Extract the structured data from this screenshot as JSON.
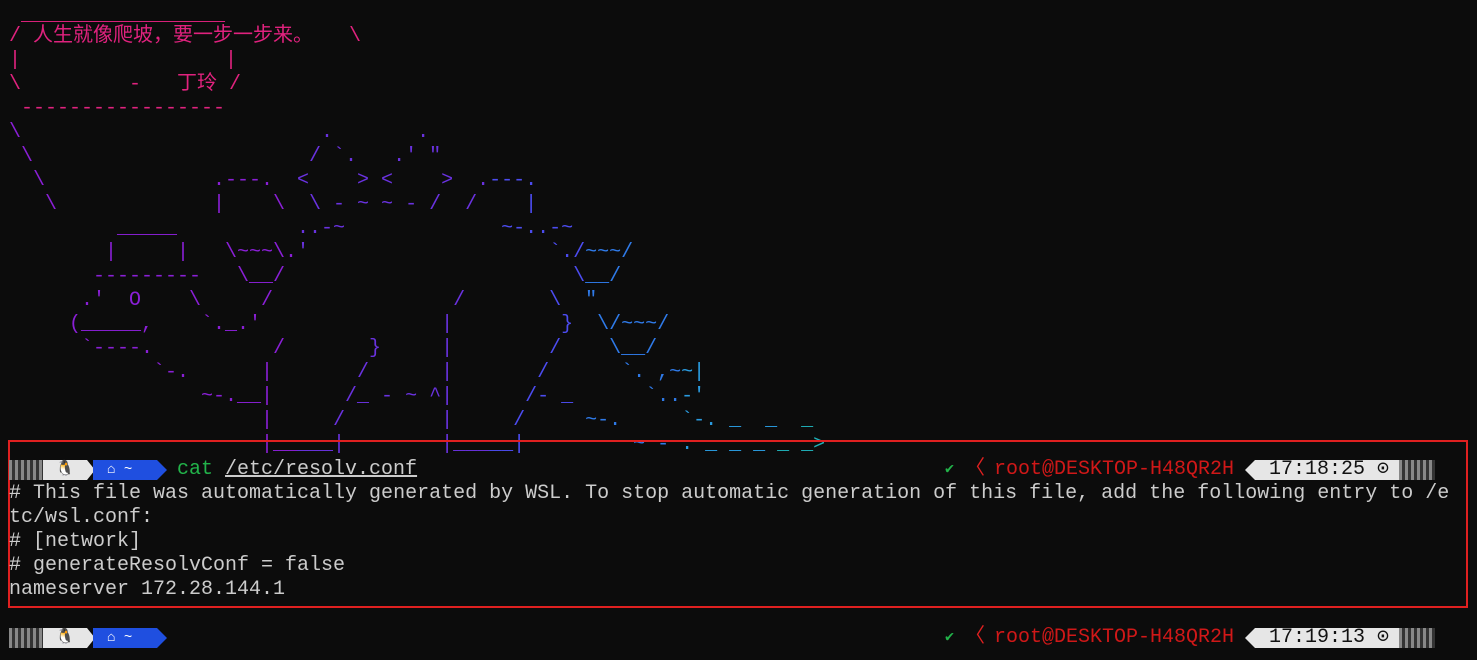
{
  "cowsay": {
    "top": " _________________",
    "line1": "/ 人生就像爬坡，要一步一步来。   \\",
    "line2": "|                 |",
    "line3": "\\         -   丁玲 /",
    "bottom": " -----------------"
  },
  "art_lines": [
    "\\                         .       .",
    " \\                       / `.   .' \"",
    "  \\              .---.  <    > <    >  .---.",
    "   \\             |    \\  \\ - ~ ~ - /  /    |",
    "         _____          ..-~             ~-..-~",
    "        |     |   \\~~~\\.'                    `./~~~/",
    "       ---------   \\__/                        \\__/",
    "      .'  O    \\     /               /       \\  \"",
    "     (_____,    `._.'               |         }  \\/~~~/",
    "      `----.          /       }     |        /    \\__/",
    "            `-.      |       /      |       /      `. ,~~|",
    "                ~-.__|      /_ - ~ ^|      /- _      `..-'",
    "                     |     /        |     /     ~-.     `-. _  _  _",
    "                     |_____|        |_____|         ~ - . _ _ _ _ _>"
  ],
  "prompt1": {
    "linux_icon": "penguin-icon",
    "home_label": "~",
    "command": "cat",
    "argument": "/etc/resolv.conf",
    "status_ok": "✔",
    "host": "root@DESKTOP-H48QR2H",
    "time": "17:18:25"
  },
  "output": [
    "# This file was automatically generated by WSL. To stop automatic generation of this file, add the following entry to /e",
    "tc/wsl.conf:",
    "# [network]",
    "# generateResolvConf = false",
    "nameserver 172.28.144.1"
  ],
  "prompt2": {
    "linux_icon": "penguin-icon",
    "home_label": "~",
    "status_ok": "✔",
    "host": "root@DESKTOP-H48QR2H",
    "time": "17:19:13"
  },
  "colors": {
    "background": "#0c0c0c",
    "bubble": "#e0227e",
    "highlight": "#e02020",
    "home_segment": "#1f4fe0",
    "command_green": "#22b34a",
    "host_red": "#d01818"
  }
}
